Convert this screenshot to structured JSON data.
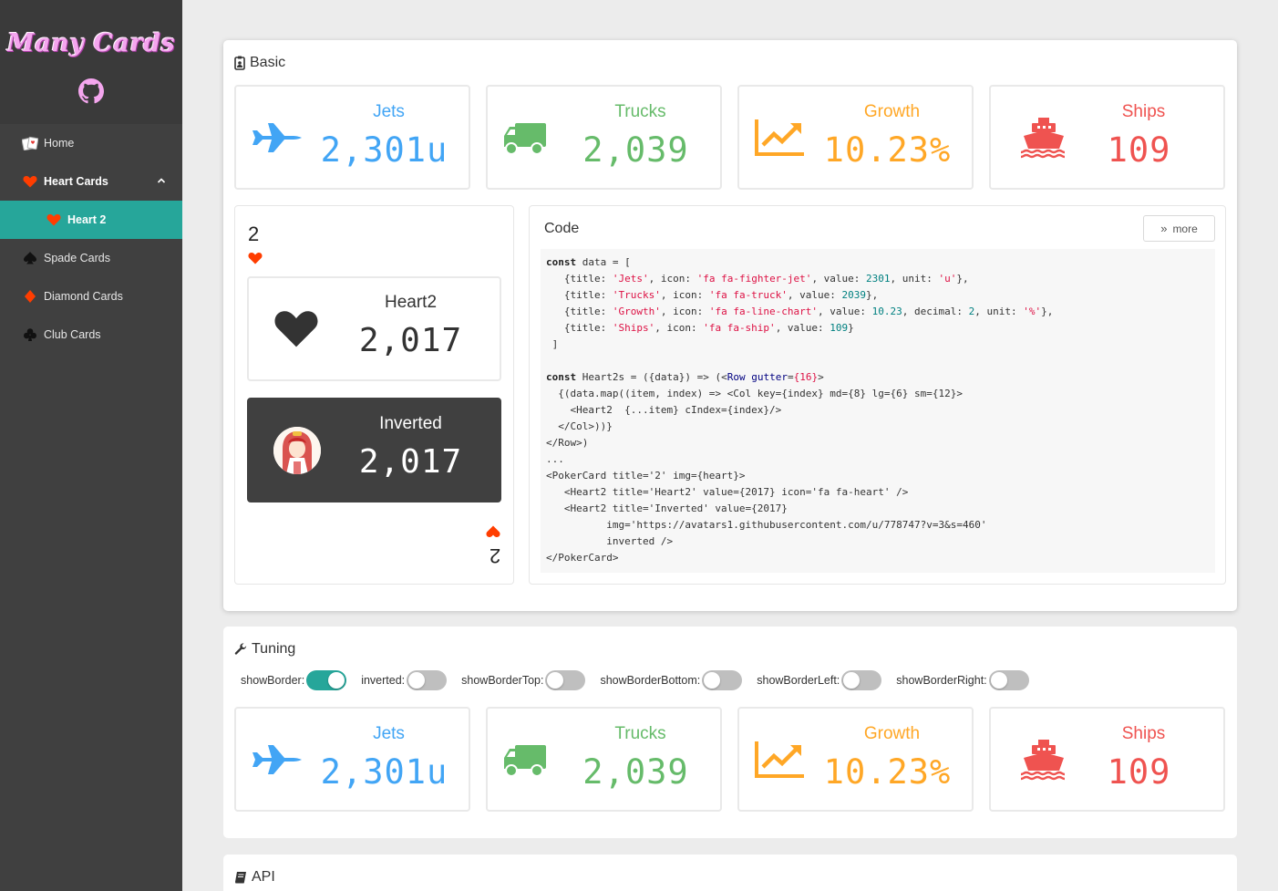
{
  "app": {
    "logo": "Many Cards"
  },
  "sidebar": {
    "items": [
      {
        "label": "Home"
      },
      {
        "label": "Heart Cards"
      },
      {
        "label": "Heart 2"
      },
      {
        "label": "Spade Cards"
      },
      {
        "label": "Diamond Cards"
      },
      {
        "label": "Club Cards"
      }
    ]
  },
  "colors": {
    "accent": "#26a69a",
    "blue": "#42a5f5",
    "green": "#66bb6a",
    "orange": "#ffa726",
    "red": "#ef5350",
    "heart": "#ff3d00"
  },
  "basic": {
    "title": "Basic",
    "cards": [
      {
        "title": "Jets",
        "value": "2,301u",
        "icon": "fighter-jet-icon",
        "color": "#42a5f5"
      },
      {
        "title": "Trucks",
        "value": "2,039",
        "icon": "truck-icon",
        "color": "#66bb6a"
      },
      {
        "title": "Growth",
        "value": "10.23%",
        "icon": "line-chart-icon",
        "color": "#ffa726"
      },
      {
        "title": "Ships",
        "value": "109",
        "icon": "ship-icon",
        "color": "#ef5350"
      }
    ],
    "poker": {
      "rank": "2",
      "heart_card": {
        "title": "Heart2",
        "value": "2,017"
      },
      "inverted_card": {
        "title": "Inverted",
        "value": "2,017"
      }
    },
    "code": {
      "title": "Code",
      "more_label": "more"
    }
  },
  "tuning": {
    "title": "Tuning",
    "toggles": [
      {
        "label": "showBorder:",
        "on": true
      },
      {
        "label": "inverted:",
        "on": false
      },
      {
        "label": "showBorderTop:",
        "on": false
      },
      {
        "label": "showBorderBottom:",
        "on": false
      },
      {
        "label": "showBorderLeft:",
        "on": false
      },
      {
        "label": "showBorderRight:",
        "on": false
      }
    ],
    "cards": [
      {
        "title": "Jets",
        "value": "2,301u"
      },
      {
        "title": "Trucks",
        "value": "2,039"
      },
      {
        "title": "Growth",
        "value": "10.23%"
      },
      {
        "title": "Ships",
        "value": "109"
      }
    ]
  },
  "api": {
    "title": "API"
  }
}
